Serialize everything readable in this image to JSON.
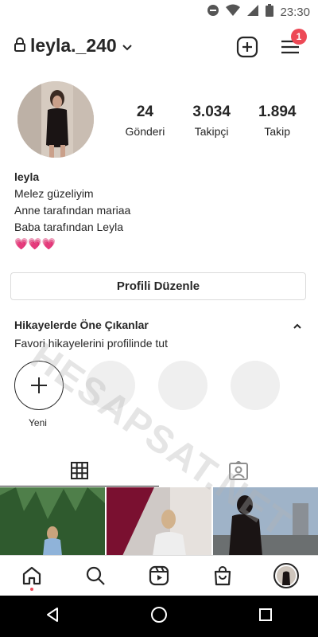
{
  "status_bar": {
    "time": "23:30"
  },
  "header": {
    "username": "leyla._240",
    "notification_count": "1"
  },
  "profile": {
    "stats": [
      {
        "value": "24",
        "label": "Gönderi"
      },
      {
        "value": "3.034",
        "label": "Takipçi"
      },
      {
        "value": "1.894",
        "label": "Takip"
      }
    ],
    "bio": {
      "name": "leyla",
      "lines": [
        "Melez güzeliyim",
        "Anne tarafından mariaa",
        "Baba tarafından Leyla"
      ],
      "hearts": "💗💗💗"
    },
    "edit_button": "Profili Düzenle"
  },
  "highlights": {
    "title": "Hikayelerde Öne Çıkanlar",
    "subtitle": "Favori hikayelerini profilinde tut",
    "new_label": "Yeni"
  },
  "watermark": "HESAPSAT.NET",
  "colors": {
    "badge": "#ed4956",
    "text": "#262626",
    "border": "#dbdbdb"
  }
}
